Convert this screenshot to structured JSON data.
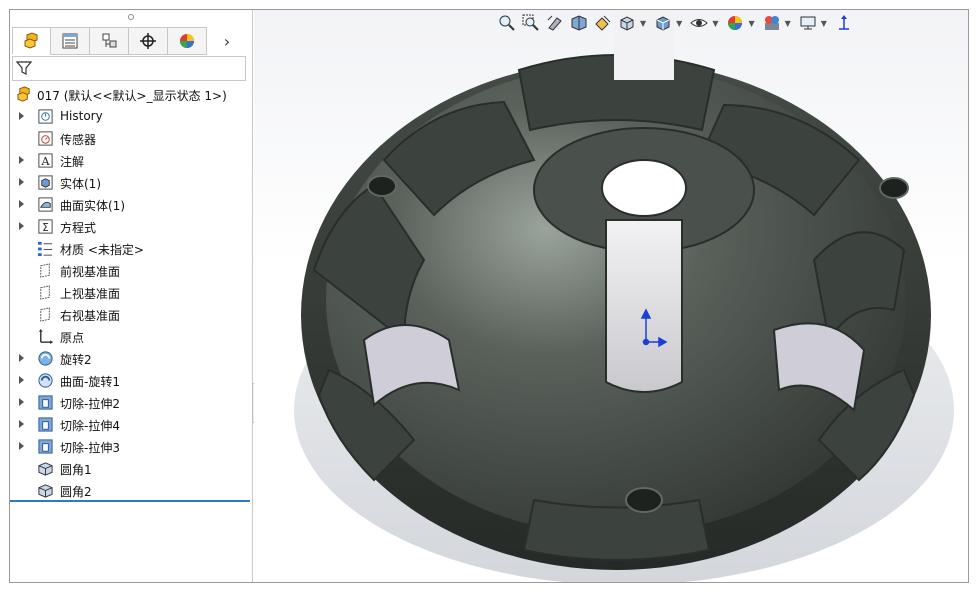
{
  "feature_tree": {
    "root_label": "017  (默认<<默认>_显示状态 1>)",
    "items": [
      {
        "label": "History",
        "icon": "history-icon",
        "expandable": true
      },
      {
        "label": "传感器",
        "icon": "sensor-icon",
        "expandable": false
      },
      {
        "label": "注解",
        "icon": "annotation-icon",
        "expandable": true
      },
      {
        "label": "实体(1)",
        "icon": "solid-body-icon",
        "expandable": true
      },
      {
        "label": "曲面实体(1)",
        "icon": "surface-body-icon",
        "expandable": true
      },
      {
        "label": "方程式",
        "icon": "equation-icon",
        "expandable": true
      },
      {
        "label": "材质 <未指定>",
        "icon": "material-icon",
        "expandable": false
      },
      {
        "label": "前视基准面",
        "icon": "plane-icon",
        "expandable": false
      },
      {
        "label": "上视基准面",
        "icon": "plane-icon",
        "expandable": false
      },
      {
        "label": "右视基准面",
        "icon": "plane-icon",
        "expandable": false
      },
      {
        "label": "原点",
        "icon": "origin-icon",
        "expandable": false
      },
      {
        "label": "旋转2",
        "icon": "revolve-icon",
        "expandable": true
      },
      {
        "label": "曲面-旋转1",
        "icon": "surface-revolve-icon",
        "expandable": true
      },
      {
        "label": "切除-拉伸2",
        "icon": "cut-extrude-icon",
        "expandable": true
      },
      {
        "label": "切除-拉伸4",
        "icon": "cut-extrude-icon",
        "expandable": true
      },
      {
        "label": "切除-拉伸3",
        "icon": "cut-extrude-icon",
        "expandable": true
      },
      {
        "label": "圆角1",
        "icon": "fillet-icon",
        "expandable": false
      },
      {
        "label": "圆角2",
        "icon": "fillet-icon",
        "expandable": false
      }
    ]
  },
  "tabs": [
    "featuremanager-tab",
    "propertymanager-tab",
    "configurationmanager-tab",
    "dimxpert-tab",
    "display-manager-tab"
  ],
  "colors": {
    "accent": "#2e7bc4",
    "part_dark": "#3f4540",
    "part_light": "#8a928c"
  }
}
